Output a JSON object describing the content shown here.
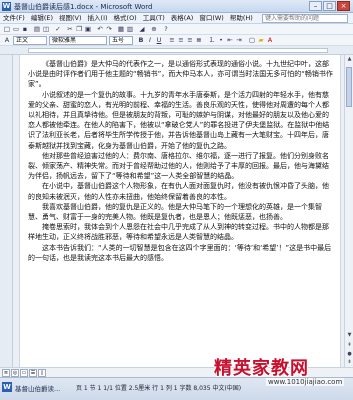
{
  "window": {
    "title": "基督山伯爵读后感1.docx - Microsoft Word",
    "app_icon": "W",
    "buttons": {
      "minimize": "–",
      "maximize": "□",
      "close": "×"
    }
  },
  "menu": {
    "items": [
      "文件(F)",
      "编辑(E)",
      "视图(V)",
      "插入(I)",
      "格式(O)",
      "工具(T)",
      "表格(A)",
      "窗口(W)",
      "帮助(H)"
    ],
    "help_placeholder": "键入需要帮助的问题"
  },
  "toolbar": {
    "style": "正文",
    "font": "微软雅黑",
    "size": "五号"
  },
  "document": {
    "paragraphs": [
      "《基督山伯爵》是大仲马的代表作之一，是以通俗形式表现的通俗小说。十九世纪中叶，这部小说是由时评作者们用于他主题的“畅销书”，而大仲马本人，亦可谓当时法国无多可怕的“畅销书作家”。",
      "小说叙述的是一个复仇的故事。十九岁的青年水手唐泰斯，是个活力四射的年轻水手，他有慈爱的父亲、甜蜜的恋人，有光明的前程、幸福的生活。善良乐观的天性，使得他对周遭的每个人都以礼相待，并且真挚待他。但是被朋友的背叛，可耻的嫉妒与阴谋，对他最好的朋友以及他心爱的恋人都被他牵连。在他人的陷害下，他被以“拿破仑党人”的罪名投进了伊夫堡监狱。在监狱中他结识了法利亚长老，后者将毕生所学传授于他，并告诉他基督山岛上藏有一大笔财宝。十四年后，唐泰斯越狱并找到宝藏，化身为基督山伯爵，开始了他的复仇之路。",
      "他对那些曾经迫害过他的人：费尔南、唐格拉尔、维尔福，逐一进行了报复。他们分别身败名裂、倾家荡产、精神失常。而对于曾经帮助过他的人，他则给予了丰厚的回报。最后，他与海黛结为伴侣，扬帆远去，留下了“等待和希望”这一人类全部智慧的结晶。",
      "在小说中，基督山伯爵这个人物形象，在有仇人面对面复仇时，他没有被仇恨冲昏了头脑，他的良知未被泯灭，他的人性亦未扭曲，他始终保留着善良的本性。",
      "我喜欢基督山伯爵，他的复仇是正义的。他是大仲马笔下的一个理想化的英雄，是一个集智慧、勇气、财富于一身的完美人物。他既是复仇者，也是恩人；他既惩恶，也扬善。",
      "掩卷思索时，我体会到个人恩怨在社会中几乎完成了从人到神的转变过程。书中的人物都是那样地生动，正义终将战胜邪恶，等待和希望永远是人类智慧的结晶。",
      "这本书告诉我们：“人类的一切智慧是包含在这四个字里面的：‘等待’和‘希望’！”这是书中最后的一句话，也是我读完这本书后最大的感悟。"
    ]
  },
  "statusbar": {
    "task_title": "基督山伯爵读...",
    "text": "页 1  节 1  1/1  位置 2.5厘米  行 1  列 1  字数 8,035  中文(中国)"
  },
  "watermark": {
    "title": "精英家教网",
    "url": "www.1010jiajiao.com"
  }
}
